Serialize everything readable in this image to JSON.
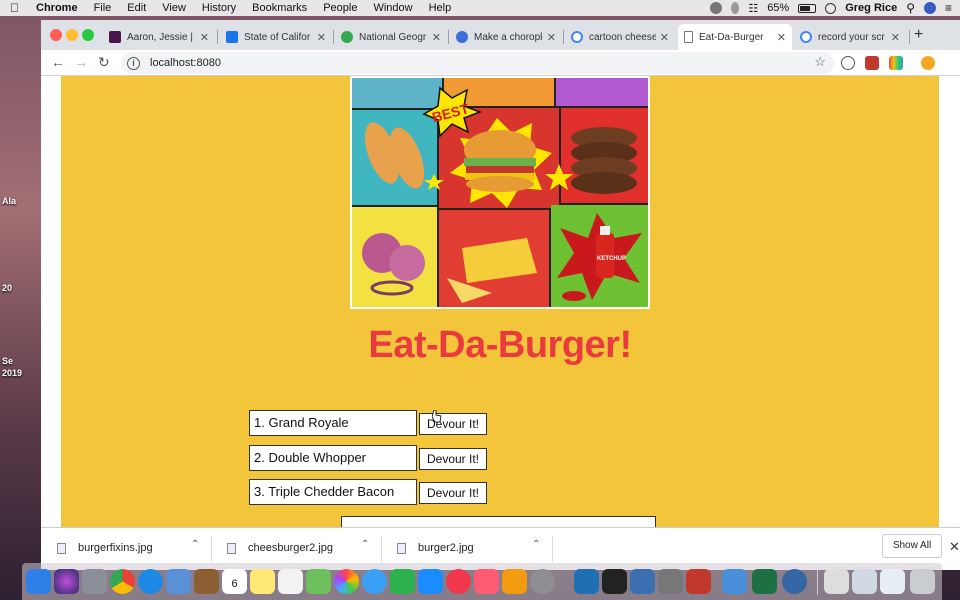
{
  "menubar": {
    "app_name": "Chrome",
    "items": [
      "File",
      "Edit",
      "View",
      "History",
      "Bookmarks",
      "People",
      "Window",
      "Help"
    ],
    "battery": "65%",
    "user": "Greg Rice"
  },
  "desktop": {
    "labels": [
      "Ala",
      "20",
      "Se",
      "2019"
    ]
  },
  "browser": {
    "tabs": [
      {
        "label": "Aaron, Jessie |",
        "favicon": "slack-icon",
        "color": "#4a154b"
      },
      {
        "label": "State of Califor",
        "favicon": "map-icon",
        "color": "#1a73e8"
      },
      {
        "label": "National Geogr",
        "favicon": "globe-icon",
        "color": "#34a853"
      },
      {
        "label": "Make a chorople",
        "favicon": "chart-icon",
        "color": "#3c6fd8"
      },
      {
        "label": "cartoon cheese",
        "favicon": "google-icon",
        "color": "#4285f4"
      },
      {
        "label": "Eat-Da-Burger",
        "favicon": "page-icon",
        "color": "#999999"
      },
      {
        "label": "record your scr",
        "favicon": "google-icon",
        "color": "#4285f4"
      }
    ],
    "active_tab": 5,
    "url": "localhost:8080"
  },
  "page": {
    "title": "Eat-Da-Burger!",
    "burgers": [
      {
        "name": "1. Grand Royale",
        "button": "Devour It!"
      },
      {
        "name": "2. Double Whopper",
        "button": "Devour It!"
      },
      {
        "name": "3. Triple Chedder Bacon",
        "button": "Devour It!"
      }
    ],
    "hero_labels": {
      "burst": "BEST",
      "bottle": "KETCHUP"
    },
    "colors": {
      "background": "#f3c53b",
      "title": "#ea3a3f"
    }
  },
  "downloads": {
    "files": [
      "burgerfixins.jpg",
      "cheesburger2.jpg",
      "burger2.jpg"
    ],
    "show_all": "Show All"
  },
  "dock": {
    "calendar_day": "6"
  }
}
